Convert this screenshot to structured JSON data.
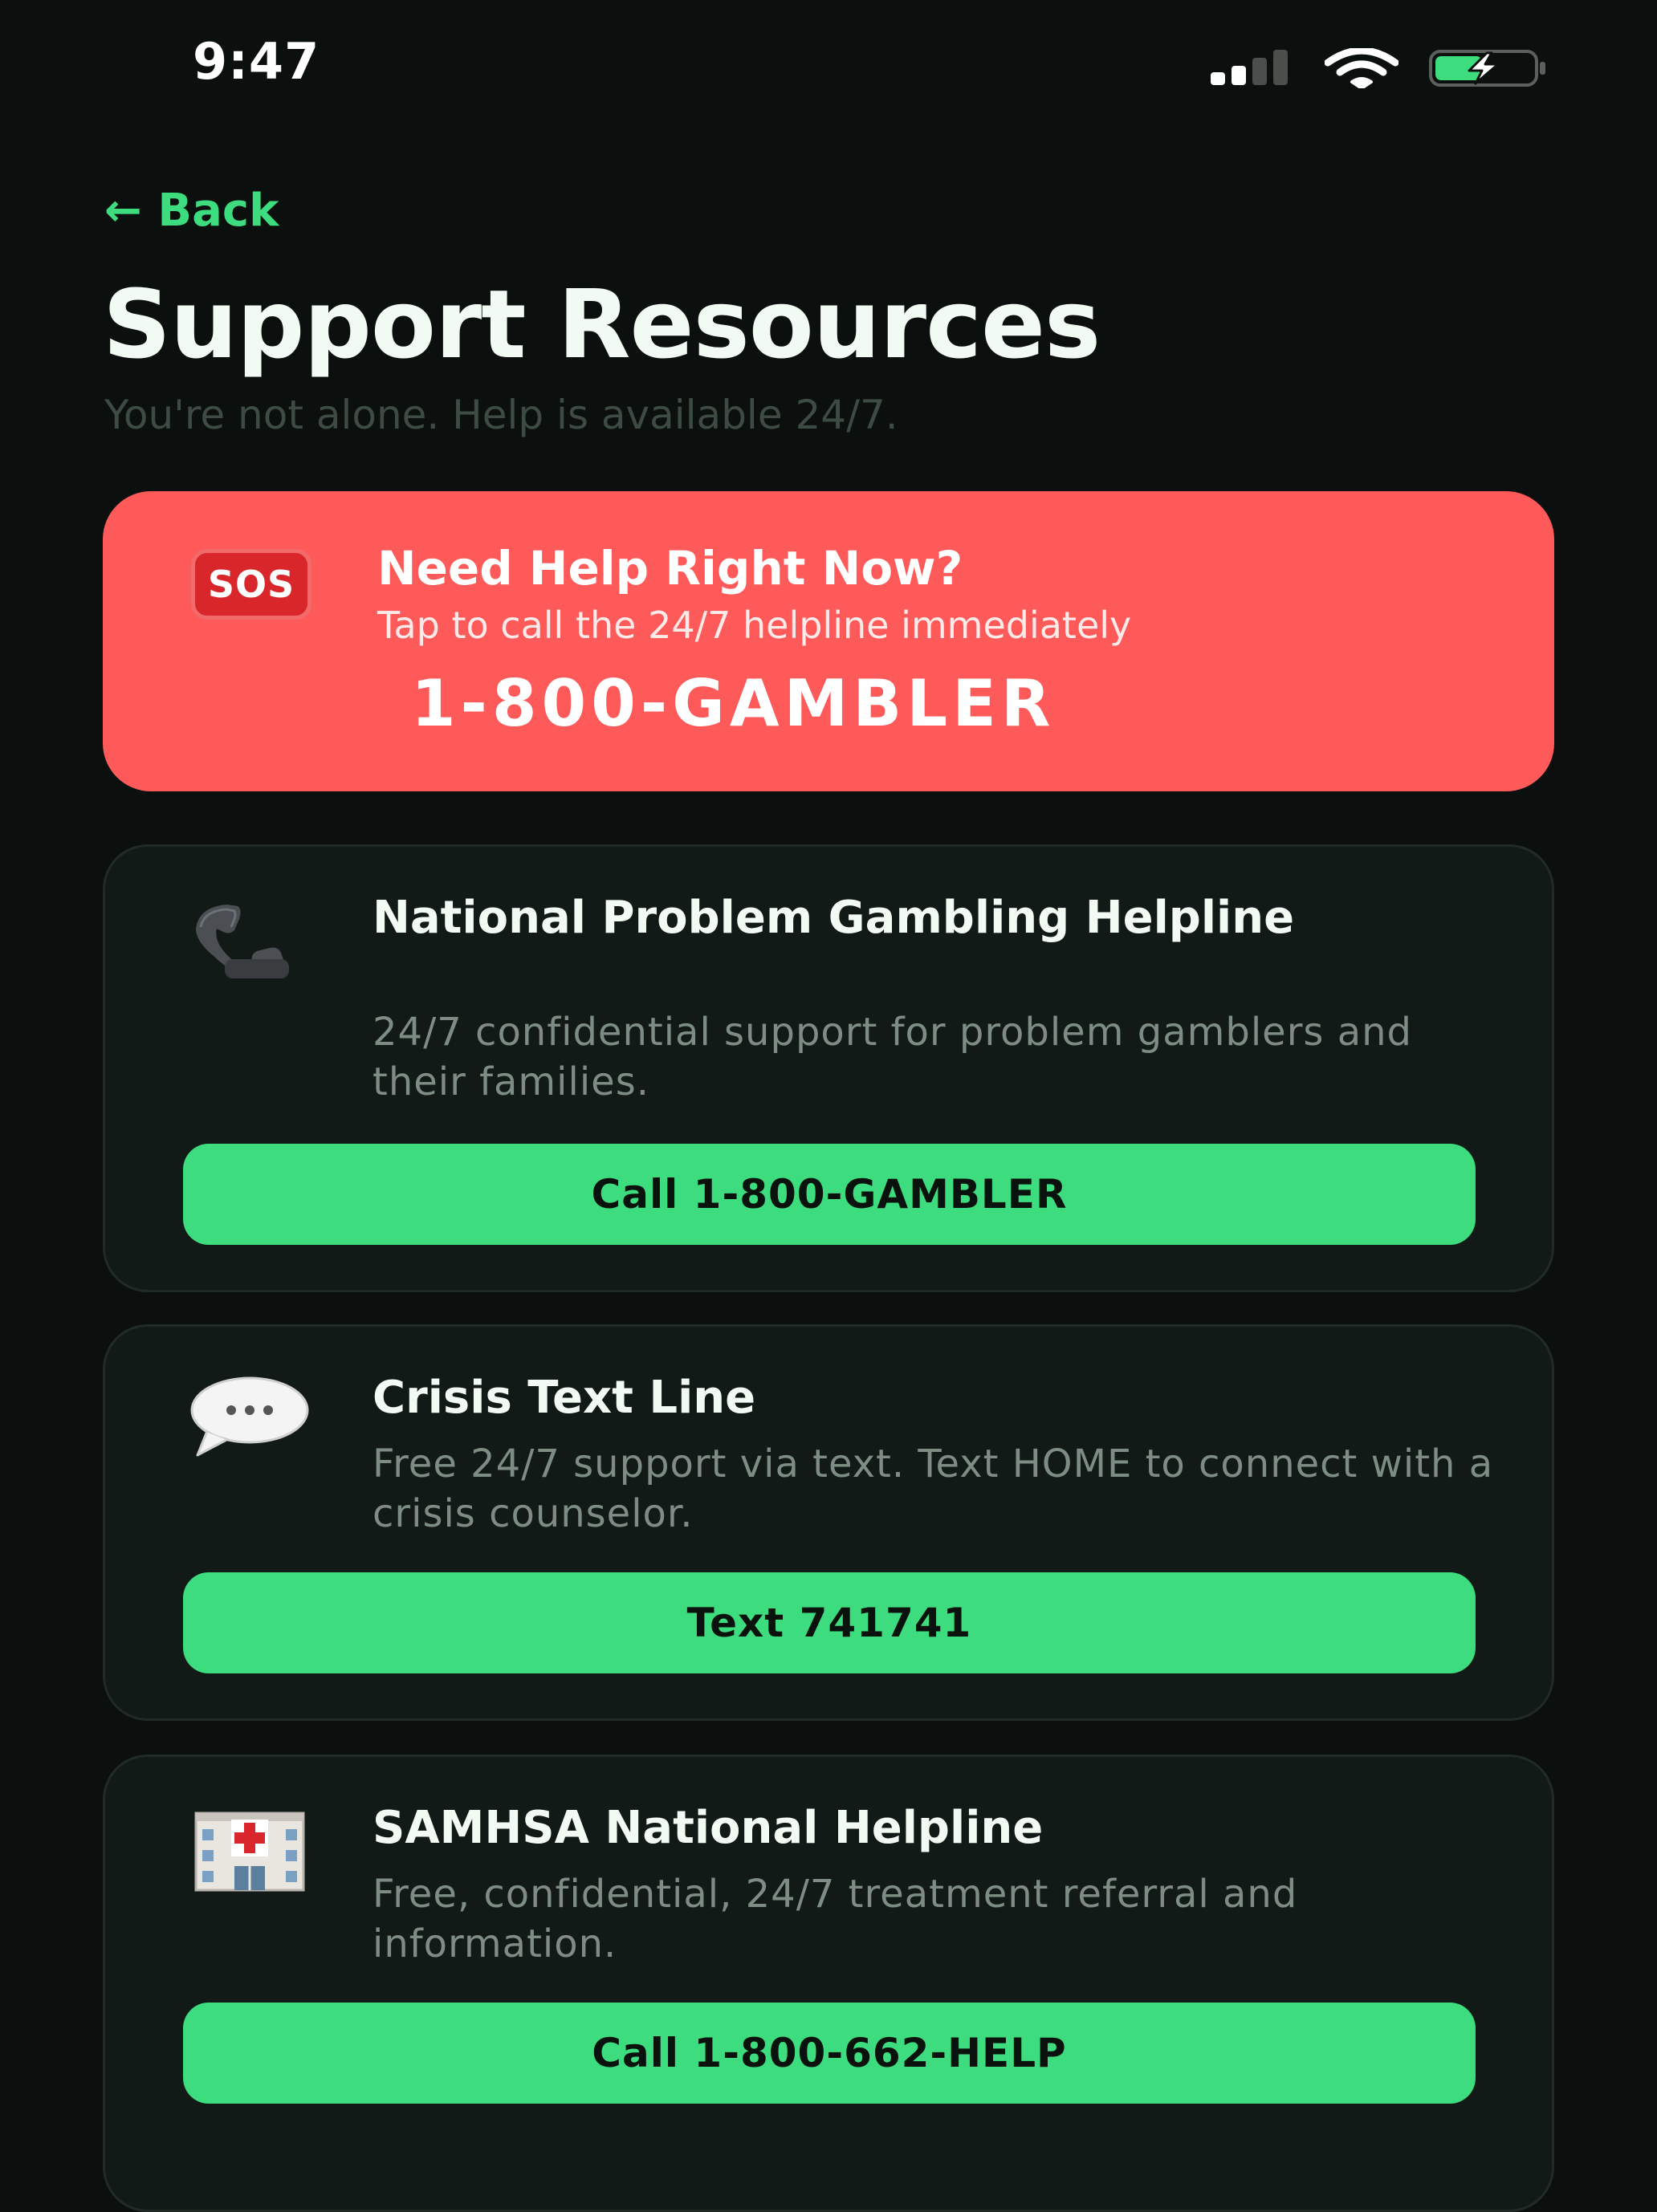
{
  "status_bar": {
    "time": "9:47"
  },
  "header": {
    "back_label": "← Back",
    "title": "Support Resources",
    "subtitle": "You're not alone. Help is available 24/7."
  },
  "emergency": {
    "badge": "SOS",
    "title": "Need Help Right Now?",
    "subtitle": "Tap to call the 24/7 helpline immediately",
    "number": "1-800-GAMBLER"
  },
  "resources": [
    {
      "icon": "telephone-icon",
      "title": "National Problem Gambling Helpline",
      "description": "24/7 confidential support for problem gamblers and their families.",
      "button": "Call 1-800-GAMBLER"
    },
    {
      "icon": "speech-bubble-icon",
      "title": "Crisis Text Line",
      "description": "Free 24/7 support via text. Text HOME to connect with a crisis counselor.",
      "button": "Text 741741"
    },
    {
      "icon": "hospital-icon",
      "title": "SAMHSA National Helpline",
      "description": "Free, confidential, 24/7 treatment referral and information.",
      "button": "Call 1-800-662-HELP"
    }
  ],
  "colors": {
    "background": "#0b0f0d",
    "accent": "#3ddc7e",
    "emergency": "#fd5a59",
    "card": "#121a17",
    "muted_text": "#7e8d84"
  }
}
